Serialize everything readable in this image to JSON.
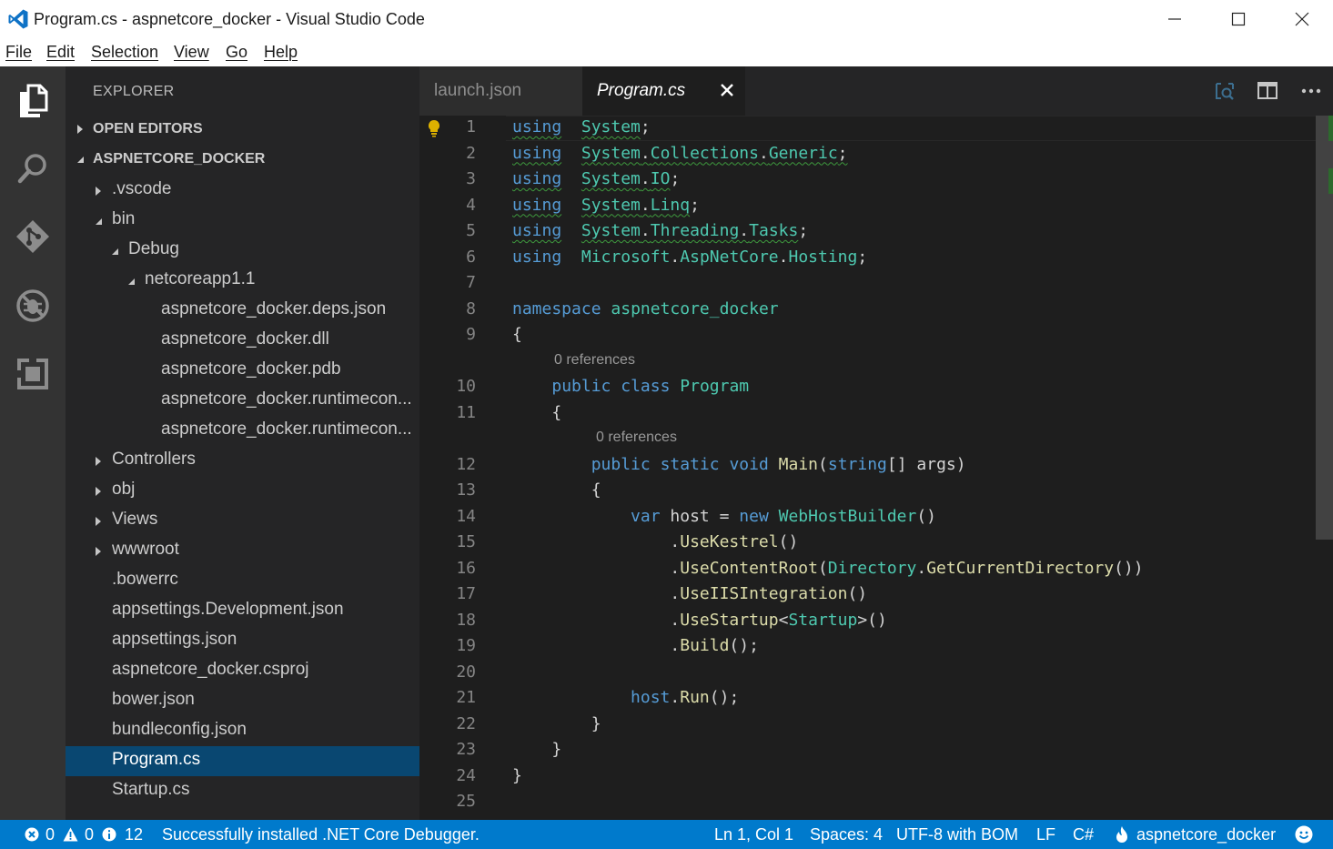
{
  "window": {
    "title": "Program.cs - aspnetcore_docker - Visual Studio Code"
  },
  "menu": [
    "File",
    "Edit",
    "Selection",
    "View",
    "Go",
    "Help"
  ],
  "activity": [
    "explorer-icon",
    "search-icon",
    "git-icon",
    "debug-icon",
    "extensions-icon"
  ],
  "sidebar": {
    "title": "EXPLORER",
    "sections": {
      "open_editors": "OPEN EDITORS",
      "project": "ASPNETCORE_DOCKER"
    },
    "tree": [
      {
        "label": ".vscode",
        "depth": 0,
        "type": "folder",
        "expanded": false
      },
      {
        "label": "bin",
        "depth": 0,
        "type": "folder",
        "expanded": true
      },
      {
        "label": "Debug",
        "depth": 1,
        "type": "folder",
        "expanded": true
      },
      {
        "label": "netcoreapp1.1",
        "depth": 2,
        "type": "folder",
        "expanded": true
      },
      {
        "label": "aspnetcore_docker.deps.json",
        "depth": 3,
        "type": "file"
      },
      {
        "label": "aspnetcore_docker.dll",
        "depth": 3,
        "type": "file"
      },
      {
        "label": "aspnetcore_docker.pdb",
        "depth": 3,
        "type": "file"
      },
      {
        "label": "aspnetcore_docker.runtimecon...",
        "depth": 3,
        "type": "file"
      },
      {
        "label": "aspnetcore_docker.runtimecon...",
        "depth": 3,
        "type": "file"
      },
      {
        "label": "Controllers",
        "depth": 0,
        "type": "folder",
        "expanded": false
      },
      {
        "label": "obj",
        "depth": 0,
        "type": "folder",
        "expanded": false
      },
      {
        "label": "Views",
        "depth": 0,
        "type": "folder",
        "expanded": false
      },
      {
        "label": "wwwroot",
        "depth": 0,
        "type": "folder",
        "expanded": false
      },
      {
        "label": ".bowerrc",
        "depth": 0,
        "type": "file"
      },
      {
        "label": "appsettings.Development.json",
        "depth": 0,
        "type": "file"
      },
      {
        "label": "appsettings.json",
        "depth": 0,
        "type": "file"
      },
      {
        "label": "aspnetcore_docker.csproj",
        "depth": 0,
        "type": "file"
      },
      {
        "label": "bower.json",
        "depth": 0,
        "type": "file"
      },
      {
        "label": "bundleconfig.json",
        "depth": 0,
        "type": "file"
      },
      {
        "label": "Program.cs",
        "depth": 0,
        "type": "file",
        "selected": true
      },
      {
        "label": "Startup.cs",
        "depth": 0,
        "type": "file"
      }
    ]
  },
  "tabs": [
    {
      "label": "launch.json",
      "active": false
    },
    {
      "label": "Program.cs",
      "active": true
    }
  ],
  "code": {
    "lines": [
      {
        "n": "1",
        "tokens": [
          [
            "kw sq",
            "using"
          ],
          [
            "",
            "  "
          ],
          [
            "ty sq",
            "System"
          ],
          [
            "",
            ";"
          ]
        ]
      },
      {
        "n": "2",
        "tokens": [
          [
            "kw sq",
            "using"
          ],
          [
            "",
            "  "
          ],
          [
            "ty sq",
            "System"
          ],
          [
            "sq",
            "."
          ],
          [
            "ty sq",
            "Collections"
          ],
          [
            "sq",
            "."
          ],
          [
            "ty sq",
            "Generic"
          ],
          [
            "sq",
            ";"
          ]
        ]
      },
      {
        "n": "3",
        "tokens": [
          [
            "kw sq",
            "using"
          ],
          [
            "",
            "  "
          ],
          [
            "ty sq",
            "System"
          ],
          [
            "sq",
            "."
          ],
          [
            "ty sq",
            "IO"
          ],
          [
            "",
            ";"
          ]
        ]
      },
      {
        "n": "4",
        "tokens": [
          [
            "kw sq",
            "using"
          ],
          [
            "",
            "  "
          ],
          [
            "ty sq",
            "System"
          ],
          [
            "sq",
            "."
          ],
          [
            "ty sq",
            "Linq"
          ],
          [
            "",
            ";"
          ]
        ]
      },
      {
        "n": "5",
        "tokens": [
          [
            "kw sq",
            "using"
          ],
          [
            "",
            "  "
          ],
          [
            "ty sq",
            "System"
          ],
          [
            "sq",
            "."
          ],
          [
            "ty sq",
            "Threading"
          ],
          [
            "sq",
            "."
          ],
          [
            "ty sq",
            "Tasks"
          ],
          [
            "",
            ";"
          ]
        ]
      },
      {
        "n": "6",
        "tokens": [
          [
            "kw",
            "using"
          ],
          [
            "",
            "  "
          ],
          [
            "ty",
            "Microsoft"
          ],
          [
            "",
            "."
          ],
          [
            "ty",
            "AspNetCore"
          ],
          [
            "",
            "."
          ],
          [
            "ty",
            "Hosting"
          ],
          [
            "",
            ";"
          ]
        ]
      },
      {
        "n": "7",
        "tokens": []
      },
      {
        "n": "8",
        "tokens": [
          [
            "kw",
            "namespace"
          ],
          [
            "",
            " "
          ],
          [
            "ty",
            "aspnetcore_docker"
          ]
        ]
      },
      {
        "n": "9",
        "tokens": [
          [
            "",
            "{"
          ]
        ]
      },
      {
        "lens": "0 references",
        "indent": 1
      },
      {
        "n": "10",
        "tokens": [
          [
            "",
            "    "
          ],
          [
            "kw",
            "public"
          ],
          [
            "",
            " "
          ],
          [
            "kw",
            "class"
          ],
          [
            "",
            " "
          ],
          [
            "ty",
            "Program"
          ]
        ]
      },
      {
        "n": "11",
        "tokens": [
          [
            "",
            "    {"
          ]
        ]
      },
      {
        "lens": "0 references",
        "indent": 2
      },
      {
        "n": "12",
        "tokens": [
          [
            "",
            "        "
          ],
          [
            "kw",
            "public"
          ],
          [
            "",
            " "
          ],
          [
            "kw",
            "static"
          ],
          [
            "",
            " "
          ],
          [
            "kw",
            "void"
          ],
          [
            "",
            " "
          ],
          [
            "fn",
            "Main"
          ],
          [
            "",
            "("
          ],
          [
            "kw",
            "string"
          ],
          [
            "",
            "[] args)"
          ]
        ]
      },
      {
        "n": "13",
        "tokens": [
          [
            "",
            "        {"
          ]
        ]
      },
      {
        "n": "14",
        "tokens": [
          [
            "",
            "            "
          ],
          [
            "kw",
            "var"
          ],
          [
            "",
            " host = "
          ],
          [
            "kw",
            "new"
          ],
          [
            "",
            " "
          ],
          [
            "ty",
            "WebHostBuilder"
          ],
          [
            "",
            "()"
          ]
        ]
      },
      {
        "n": "15",
        "tokens": [
          [
            "",
            "                ."
          ],
          [
            "fn",
            "UseKestrel"
          ],
          [
            "",
            "()"
          ]
        ]
      },
      {
        "n": "16",
        "tokens": [
          [
            "",
            "                ."
          ],
          [
            "fn",
            "UseContentRoot"
          ],
          [
            "",
            "("
          ],
          [
            "ty",
            "Directory"
          ],
          [
            "",
            "."
          ],
          [
            "fn",
            "GetCurrentDirectory"
          ],
          [
            "",
            "())"
          ]
        ]
      },
      {
        "n": "17",
        "tokens": [
          [
            "",
            "                ."
          ],
          [
            "fn",
            "UseIISIntegration"
          ],
          [
            "",
            "()"
          ]
        ]
      },
      {
        "n": "18",
        "tokens": [
          [
            "",
            "                ."
          ],
          [
            "fn",
            "UseStartup"
          ],
          [
            "",
            "<"
          ],
          [
            "ty",
            "Startup"
          ],
          [
            "",
            ">()"
          ]
        ]
      },
      {
        "n": "19",
        "tokens": [
          [
            "",
            "                ."
          ],
          [
            "fn",
            "Build"
          ],
          [
            "",
            "();"
          ]
        ]
      },
      {
        "n": "20",
        "tokens": []
      },
      {
        "n": "21",
        "tokens": [
          [
            "",
            "            "
          ],
          [
            "kw",
            "host"
          ],
          [
            "",
            "."
          ],
          [
            "fn",
            "Run"
          ],
          [
            "",
            "();"
          ]
        ]
      },
      {
        "n": "22",
        "tokens": [
          [
            "",
            "        }"
          ]
        ]
      },
      {
        "n": "23",
        "tokens": [
          [
            "",
            "    }"
          ]
        ]
      },
      {
        "n": "24",
        "tokens": [
          [
            "",
            "}"
          ]
        ]
      },
      {
        "n": "25",
        "tokens": []
      }
    ]
  },
  "status": {
    "errors": "0",
    "warnings": "0",
    "infos": "12",
    "message": "Successfully installed .NET Core Debugger.",
    "position": "Ln 1, Col 1",
    "spaces": "Spaces: 4",
    "encoding": "UTF-8 with BOM",
    "eol": "LF",
    "language": "C#",
    "project": "aspnetcore_docker"
  },
  "colors": {
    "statusbar": "#007acc",
    "activitybar": "#333333",
    "sidebar": "#252526",
    "editor": "#1e1e1e",
    "selection": "#094771",
    "keyword": "#569cd6",
    "type": "#4ec9b0",
    "function": "#dcdcaa"
  }
}
